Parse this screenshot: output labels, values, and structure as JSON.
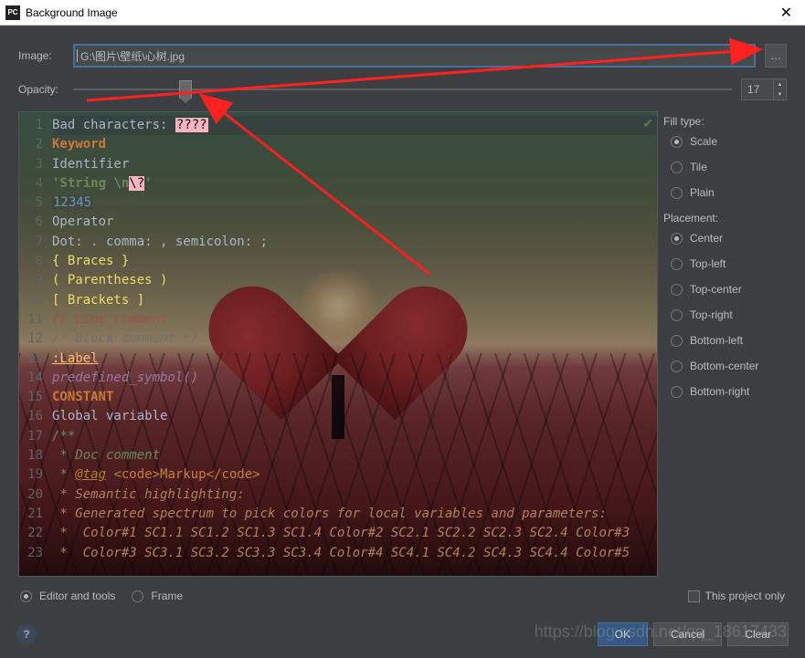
{
  "window": {
    "title": "Background Image",
    "app_icon": "PC"
  },
  "labels": {
    "image": "Image:",
    "opacity": "Opacity:"
  },
  "image_path": "G:\\图片\\壁纸\\心树.jpg",
  "opacity_value": "17",
  "fill_type": {
    "title": "Fill type:",
    "options": [
      {
        "label": "Scale",
        "checked": true
      },
      {
        "label": "Tile",
        "checked": false
      },
      {
        "label": "Plain",
        "checked": false
      }
    ]
  },
  "placement": {
    "title": "Placement:",
    "options": [
      {
        "label": "Center",
        "checked": true
      },
      {
        "label": "Top-left",
        "checked": false
      },
      {
        "label": "Top-center",
        "checked": false
      },
      {
        "label": "Top-right",
        "checked": false
      },
      {
        "label": "Bottom-left",
        "checked": false
      },
      {
        "label": "Bottom-center",
        "checked": false
      },
      {
        "label": "Bottom-right",
        "checked": false
      }
    ]
  },
  "bottom": {
    "editor_and_tools": "Editor and tools",
    "frame": "Frame",
    "project_only": "This project only"
  },
  "buttons": {
    "ok": "OK",
    "cancel": "Cancel",
    "clear": "Clear"
  },
  "watermark": "https://blog.csdn.net/qq_18617433",
  "code": {
    "line1_a": "Bad characters: ",
    "line1_b": "????",
    "line2": "Keyword",
    "line3": "Identifier",
    "line4_a": "'String \\n",
    "line4_b": "\\?",
    "line4_c": "'",
    "line5": "12345",
    "line6": "Operator",
    "line7": "Dot: . comma: , semicolon: ;",
    "line8": "{ Braces }",
    "line9": "( Parentheses )",
    "line10": "[ Brackets ]",
    "line11": "// Line comment",
    "line12": "/* Block comment */",
    "line13": ":Label",
    "line14": "predefined_symbol()",
    "line15": "CONSTANT",
    "line16": "Global variable",
    "line17": "/**",
    "line18": " * Doc comment",
    "line19_a": " * ",
    "line19_b": "@tag",
    "line19_c": " <code>Markup</code>",
    "line20": " * Semantic highlighting:",
    "line21": " * Generated spectrum to pick colors for local variables and parameters:",
    "line22": " *  Color#1 SC1.1 SC1.2 SC1.3 SC1.4 Color#2 SC2.1 SC2.2 SC2.3 SC2.4 Color#3",
    "line23": " *  Color#3 SC3.1 SC3.2 SC3.3 SC3.4 Color#4 SC4.1 SC4.2 SC4.3 SC4.4 Color#5"
  }
}
